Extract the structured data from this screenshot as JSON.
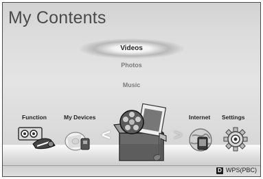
{
  "page": {
    "title": "My Contents"
  },
  "menu": {
    "items": [
      {
        "label": "Videos",
        "selected": true
      },
      {
        "label": "Photos",
        "selected": false
      },
      {
        "label": "Music",
        "selected": false
      }
    ]
  },
  "categories": [
    {
      "label": "Function",
      "icon": "function-icon"
    },
    {
      "label": "My Devices",
      "icon": "my-devices-icon"
    },
    {
      "label": "",
      "icon": "my-contents-icon",
      "selected": true
    },
    {
      "label": "Internet",
      "icon": "internet-icon"
    },
    {
      "label": "Settings",
      "icon": "settings-icon"
    }
  ],
  "nav": {
    "left_arrow": "<",
    "right_arrow": ">"
  },
  "footer": {
    "key": "D",
    "label": "WPS(PBC)"
  },
  "colors": {
    "title": "#4a4a4a",
    "selected_text": "#222222",
    "inactive_text": "#7c7c7c"
  }
}
